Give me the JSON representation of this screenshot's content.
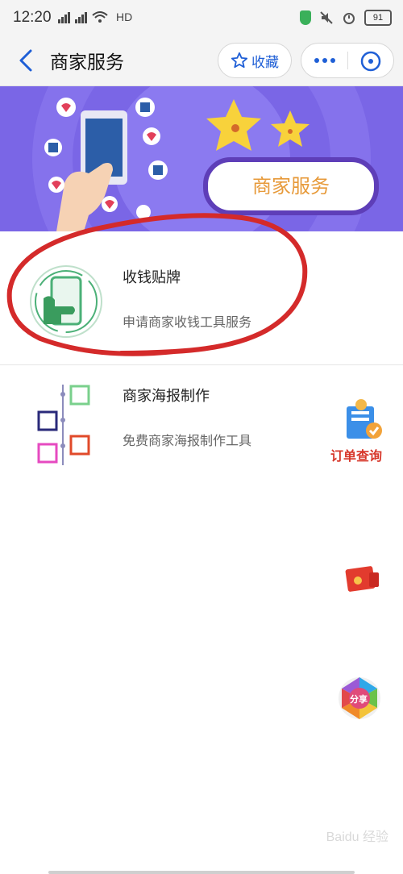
{
  "status": {
    "time": "12:20",
    "network": "HD",
    "battery": "91"
  },
  "header": {
    "title": "商家服务",
    "favorite_label": "收藏"
  },
  "banner": {
    "title": "商家服务"
  },
  "items": [
    {
      "title": "收钱贴牌",
      "desc": "申请商家收钱工具服务"
    },
    {
      "title": "商家海报制作",
      "desc": "免费商家海报制作工具"
    }
  ],
  "side": {
    "order_label": "订单查询",
    "share_label": "分享"
  },
  "watermark": "Baidu 经验",
  "colors": {
    "accent": "#1f5fd6",
    "banner_bg": "#7a66e6",
    "annotation": "#d42a2a",
    "order_label": "#d7372a"
  },
  "icons": [
    "back-icon",
    "star-icon",
    "more-icon",
    "close-circle-icon",
    "payment-sign-icon",
    "poster-icon",
    "order-query-icon",
    "red-envelope-icon",
    "share-icon"
  ]
}
